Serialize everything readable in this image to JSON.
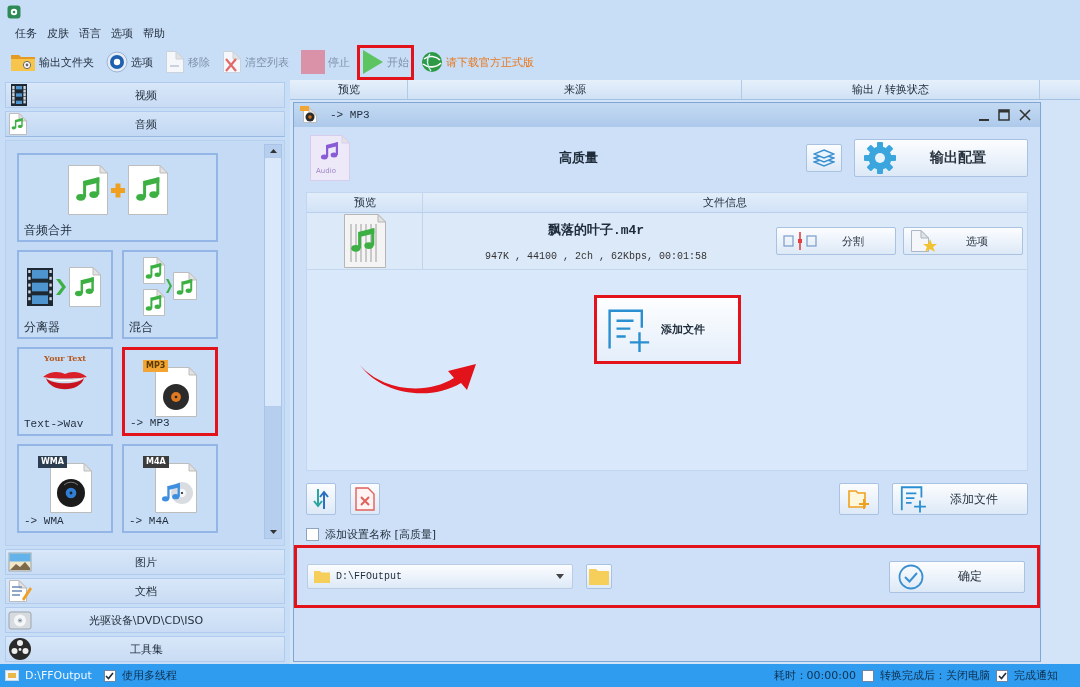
{
  "menu": [
    "任务",
    "皮肤",
    "语言",
    "选项",
    "帮助"
  ],
  "toolbar": [
    {
      "kind": "output_folder",
      "label": "输出文件夹",
      "disabled": false,
      "highlighted": false
    },
    {
      "kind": "options",
      "label": "选项",
      "disabled": false,
      "highlighted": false
    },
    {
      "kind": "remove",
      "label": "移除",
      "disabled": true,
      "highlighted": false
    },
    {
      "kind": "clear",
      "label": "清空列表",
      "disabled": true,
      "highlighted": false
    },
    {
      "kind": "stop",
      "label": "停止",
      "disabled": true,
      "highlighted": false
    },
    {
      "kind": "start",
      "label": "开始",
      "disabled": true,
      "highlighted": true
    },
    {
      "kind": "download",
      "label": "请下载官方正式版",
      "disabled": false,
      "highlighted": false
    }
  ],
  "sidebar": {
    "categories": [
      {
        "kind": "video",
        "label": "视频",
        "expanded": false
      },
      {
        "kind": "audio",
        "label": "音频",
        "expanded": true,
        "tiles": [
          {
            "kind": "join",
            "label": "音频合并",
            "highlighted": false
          },
          {
            "kind": "split",
            "label": "分离器",
            "highlighted": false
          },
          {
            "kind": "mix",
            "label": "混合",
            "highlighted": false
          },
          {
            "kind": "tts",
            "label": "Text->Wav",
            "badge": "Your Text",
            "highlighted": false
          },
          {
            "kind": "mp3",
            "label": "-> MP3",
            "badge": "MP3",
            "highlighted": true
          },
          {
            "kind": "wma",
            "label": "-> WMA",
            "badge": "WMA",
            "highlighted": false
          },
          {
            "kind": "m4a",
            "label": "-> M4A",
            "badge": "M4A",
            "highlighted": false
          }
        ]
      },
      {
        "kind": "picture",
        "label": "图片",
        "expanded": false
      },
      {
        "kind": "document",
        "label": "文档",
        "expanded": false
      },
      {
        "kind": "disc",
        "label": "光驱设备\\DVD\\CD\\ISO",
        "expanded": false
      },
      {
        "kind": "tools",
        "label": "工具集",
        "expanded": false
      }
    ]
  },
  "task_list": {
    "columns": [
      "预览",
      "来源",
      "输出 / 转换状态"
    ]
  },
  "dialog": {
    "title": "-> MP3",
    "profile": {
      "icon_caption": "Audio",
      "name": "高质量"
    },
    "output_config_button": "输出配置",
    "file_table": {
      "columns": [
        "预览",
        "文件信息"
      ],
      "rows": [
        {
          "name": "飘落的叶子.m4r",
          "info": "947K , 44100 , 2ch , 62Kbps, 00:01:58",
          "buttons": [
            {
              "kind": "split",
              "label": "分割"
            },
            {
              "kind": "options",
              "label": "选项"
            }
          ]
        }
      ]
    },
    "drop_area": {
      "arrow_annotation": true,
      "add_button": {
        "label": "添加文件",
        "highlighted": true
      }
    },
    "add_files_button": {
      "label": "添加文件"
    },
    "name_checkbox": {
      "label": "添加设置名称 [高质量]",
      "checked": false
    },
    "output_row": {
      "folder": "D:\\FFOutput",
      "highlighted": true
    },
    "ok_button": "确定"
  },
  "status_bar": {
    "folder": "D:\\FFOutput",
    "multithread": {
      "label": "使用多线程",
      "checked": true
    },
    "elapsed": "耗时：00:00:00",
    "shutdown": {
      "label": "转换完成后：关闭电脑",
      "checked": false
    },
    "notify": {
      "label": "完成通知",
      "checked": true
    }
  }
}
